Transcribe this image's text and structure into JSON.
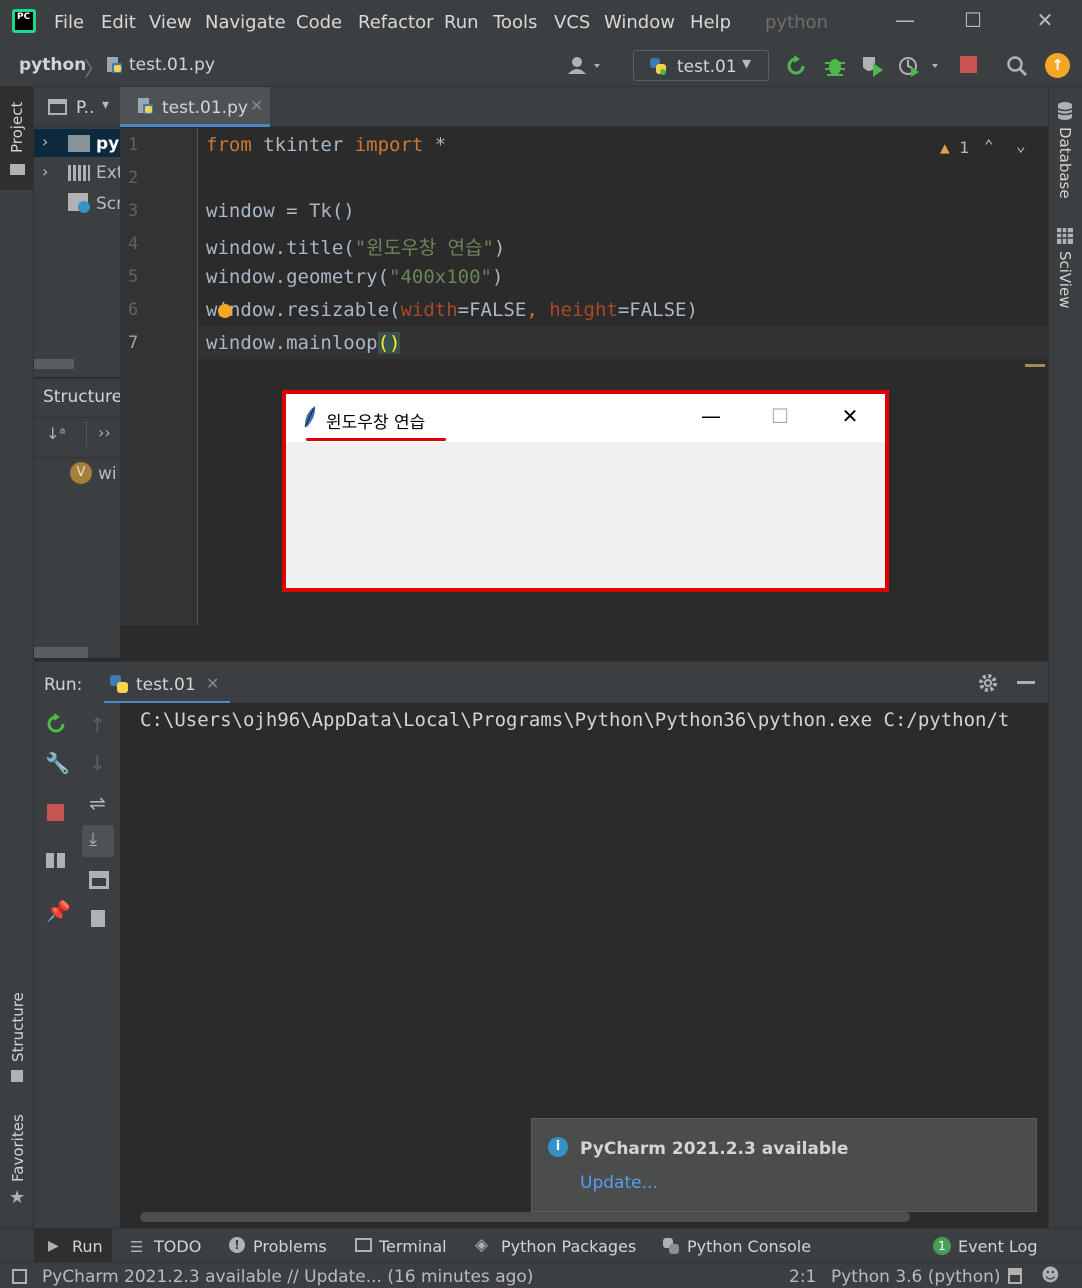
{
  "app": {
    "logo_text": "PC",
    "project_name": "python"
  },
  "menu": [
    "File",
    "Edit",
    "View",
    "Navigate",
    "Code",
    "Refactor",
    "Run",
    "Tools",
    "VCS",
    "Window",
    "Help"
  ],
  "window_controls": {
    "minimize": "—",
    "maximize": "☐",
    "close": "✕"
  },
  "nav": {
    "crumb_project": "python",
    "crumb_file": "test.01.py",
    "run_config": "test.01"
  },
  "left_strip": {
    "project": "Project",
    "structure": "Structure",
    "favorites": "Favorites"
  },
  "right_strip": {
    "database": "Database",
    "sciview": "SciView"
  },
  "project_panel": {
    "header": "P..",
    "items": [
      {
        "label": "py"
      },
      {
        "label": "Ext"
      },
      {
        "label": "Scr"
      }
    ]
  },
  "structure_panel": {
    "title": "Structure",
    "item": "wi",
    "item_badge": "V"
  },
  "editor": {
    "tab": "test.01.py",
    "warning_count": "1",
    "line_numbers": [
      "1",
      "2",
      "3",
      "4",
      "5",
      "6",
      "7"
    ],
    "lines": {
      "l1_kw1": "from",
      "l1_mod": " tkinter ",
      "l1_kw2": "import",
      "l1_rest": " *",
      "l3": "window = Tk()",
      "l4_a": "window.title(",
      "l4_s": "\"윈도우창 연습\"",
      "l4_b": ")",
      "l5_a": "window.geometry(",
      "l5_s": "\"400x100\"",
      "l5_b": ")",
      "l6_a": "window.resizable(",
      "l6_p1": "width",
      "l6_b": "=FALSE",
      "l6_c": ", ",
      "l6_p2": "height",
      "l6_d": "=FALSE)",
      "l7_a": "window.mainloop",
      "l7_b": "()"
    }
  },
  "tk_window": {
    "title": "윈도우창 연습"
  },
  "run": {
    "label": "Run:",
    "tab": "test.01",
    "command": "C:\\Users\\ojh96\\AppData\\Local\\Programs\\Python\\Python36\\python.exe C:/python/t"
  },
  "notification": {
    "title": "PyCharm 2021.2.3 available",
    "link": "Update..."
  },
  "bottom_tabs": [
    "Run",
    "TODO",
    "Problems",
    "Terminal",
    "Python Packages",
    "Python Console",
    "Event Log"
  ],
  "event_log_badge": "1",
  "status": {
    "message": "PyCharm 2021.2.3 available // Update... (16 minutes ago)",
    "position": "2:1",
    "interpreter": "Python 3.6 (python)"
  },
  "colors": {
    "accent": "#4a88c7",
    "keyword": "#cc7832",
    "string": "#6a8759",
    "highlight_box": "#e00000"
  }
}
